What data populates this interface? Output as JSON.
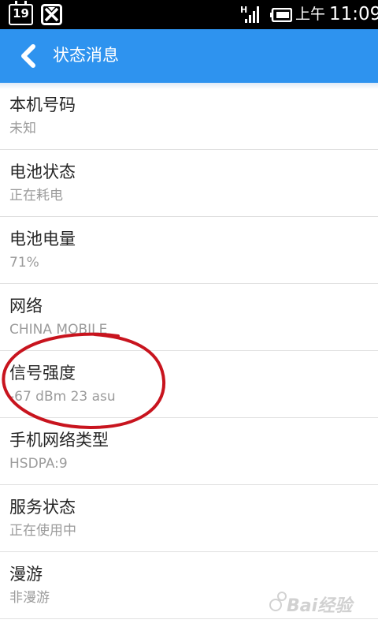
{
  "status_bar": {
    "calendar_day": "19",
    "network_type": "H",
    "ampm": "上午",
    "time": "11:09",
    "icons": [
      "calendar-icon",
      "app-notification-icon",
      "signal-icon",
      "battery-icon"
    ]
  },
  "header": {
    "title": "状态消息",
    "color": "#2e93ef"
  },
  "items": [
    {
      "title": "本机号码",
      "value": "未知"
    },
    {
      "title": "电池状态",
      "value": "正在耗电"
    },
    {
      "title": "电池电量",
      "value": "71%"
    },
    {
      "title": "网络",
      "value": "CHINA MOBILE"
    },
    {
      "title": "信号强度",
      "value": "-67 dBm   23 asu"
    },
    {
      "title": "手机网络类型",
      "value": "HSDPA:9"
    },
    {
      "title": "服务状态",
      "value": "正在使用中"
    },
    {
      "title": "漫游",
      "value": "非漫游"
    }
  ],
  "annotation": {
    "color": "#c8141e",
    "highlighted_item": "信号强度"
  },
  "watermark": {
    "text": "Bai经验"
  }
}
